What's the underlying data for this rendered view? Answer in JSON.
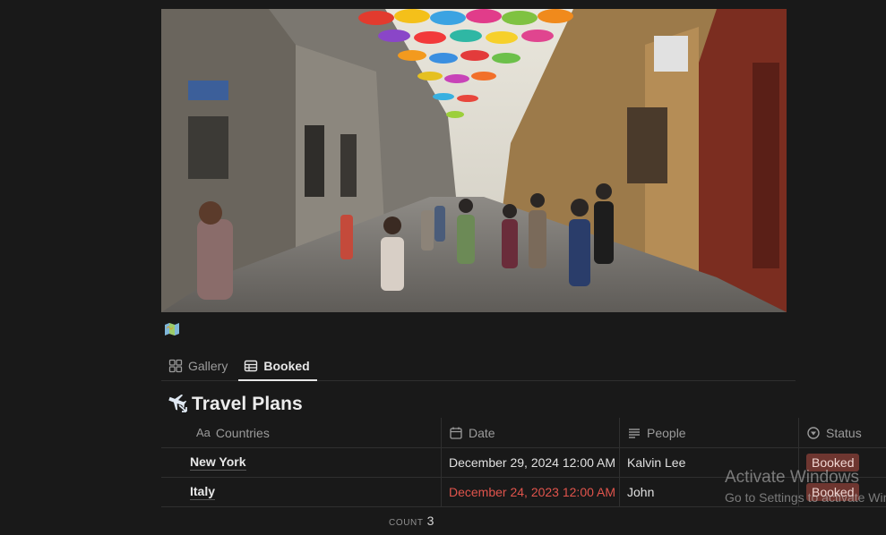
{
  "page": {
    "cover_description_icon": "map-emoji-icon",
    "title_icon": "airplane-arrow-icon"
  },
  "tabs": [
    {
      "label": "Gallery",
      "icon": "gallery-grid-icon",
      "active": false
    },
    {
      "label": "Booked",
      "icon": "table-icon",
      "active": true
    }
  ],
  "database": {
    "title": "Travel Plans"
  },
  "table": {
    "columns": [
      {
        "label": "Countries",
        "icon": "text-aa-icon"
      },
      {
        "label": "Date",
        "icon": "calendar-icon"
      },
      {
        "label": "People",
        "icon": "text-lines-icon"
      },
      {
        "label": "Status",
        "icon": "status-icon"
      }
    ],
    "rows": [
      {
        "country": "New York",
        "date": "December 29, 2024 12:00 AM",
        "date_overdue": false,
        "people": "Kalvin Lee",
        "status": "Booked"
      },
      {
        "country": "Italy",
        "date": "December 24, 2023 12:00 AM -",
        "date_overdue": true,
        "people": "John",
        "status": "Booked"
      }
    ],
    "count_label": "COUNT",
    "count_value": "3"
  },
  "watermark": {
    "title": "Activate Windows",
    "subtitle": "Go to Settings to activate Windows."
  },
  "colors": {
    "background": "#191919",
    "status_booked_bg": "#6e3630",
    "overdue_date": "#e0544c"
  }
}
